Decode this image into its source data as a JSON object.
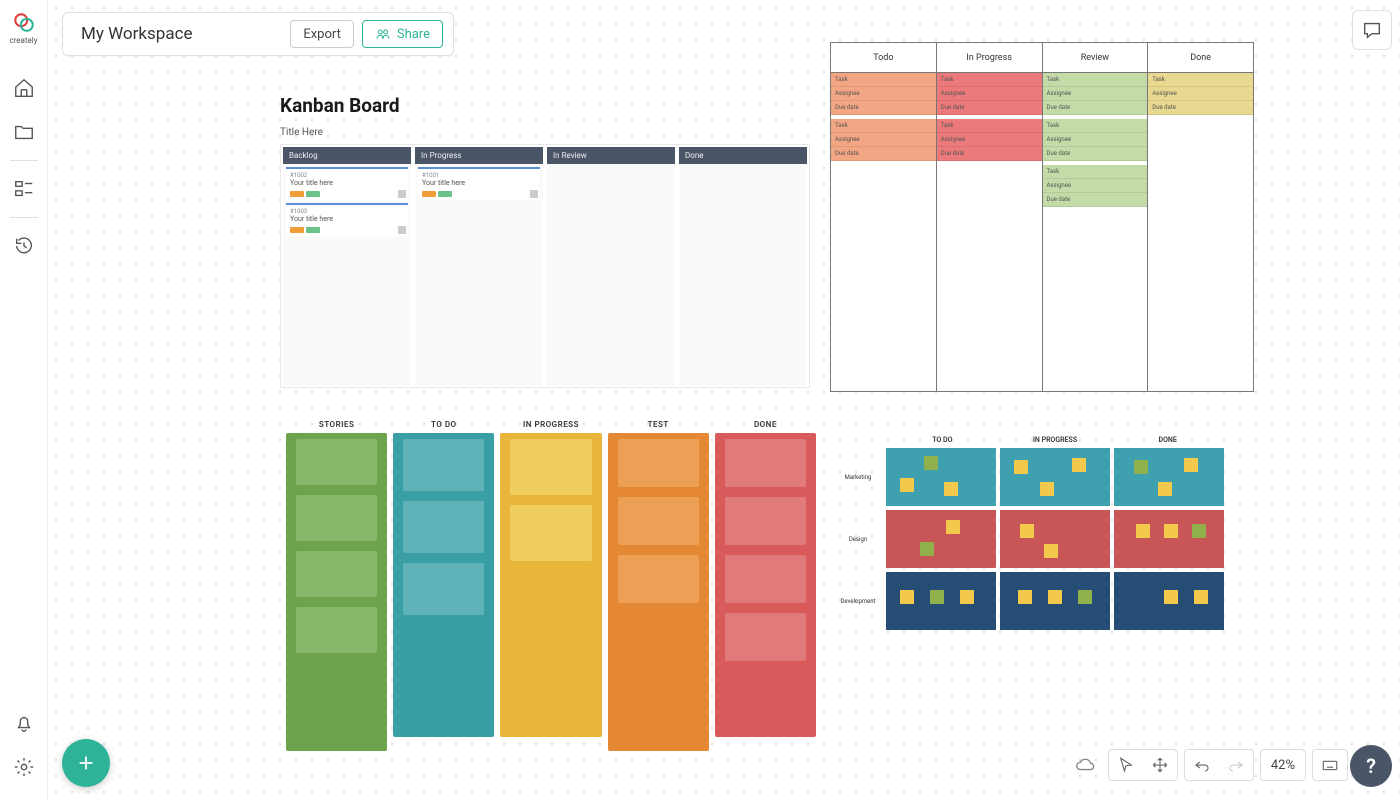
{
  "app": {
    "logo_text": "creately"
  },
  "header": {
    "workspace_title": "My Workspace",
    "export_label": "Export",
    "share_label": "Share"
  },
  "zoom": "42%",
  "fab_label": "+",
  "help_label": "?",
  "template1": {
    "title": "Kanban Board",
    "subtitle": "Title Here",
    "columns": [
      "Backlog",
      "In Progress",
      "In Review",
      "Done"
    ],
    "cards": {
      "backlog": [
        {
          "id": "#1002",
          "title": "Your title here"
        },
        {
          "id": "#1003",
          "title": "Your title here"
        }
      ],
      "in_progress": [
        {
          "id": "#1001",
          "title": "Your title here"
        }
      ]
    }
  },
  "template2": {
    "columns": [
      "Todo",
      "In Progress",
      "Review",
      "Done"
    ],
    "items_set_a": [
      "Task",
      "Assignee",
      "Due date"
    ],
    "items_set_b": [
      "Task",
      "Assignee",
      "Due date"
    ],
    "counts": {
      "todo": 2,
      "in_progress": 2,
      "review": 3,
      "done": 1
    }
  },
  "template3": {
    "headers": [
      "STORIES",
      "TO DO",
      "IN PROGRESS",
      "TEST",
      "DONE"
    ],
    "blocks": {
      "stories": 4,
      "todo": 3,
      "in_progress": 2,
      "test": 3,
      "done": 4
    },
    "colors": {
      "stories": "#6da34d",
      "todo": "#3a9ea5",
      "in_progress": "#e8b63a",
      "test": "#e58833",
      "done": "#d85a5a"
    }
  },
  "template4": {
    "col_headers": [
      "TO DO",
      "IN PROGRESS",
      "DONE"
    ],
    "row_labels": [
      "Marketing",
      "Design",
      "Development"
    ],
    "row_colors": [
      "#3fa1b0",
      "#c85656",
      "#264d73"
    ]
  }
}
